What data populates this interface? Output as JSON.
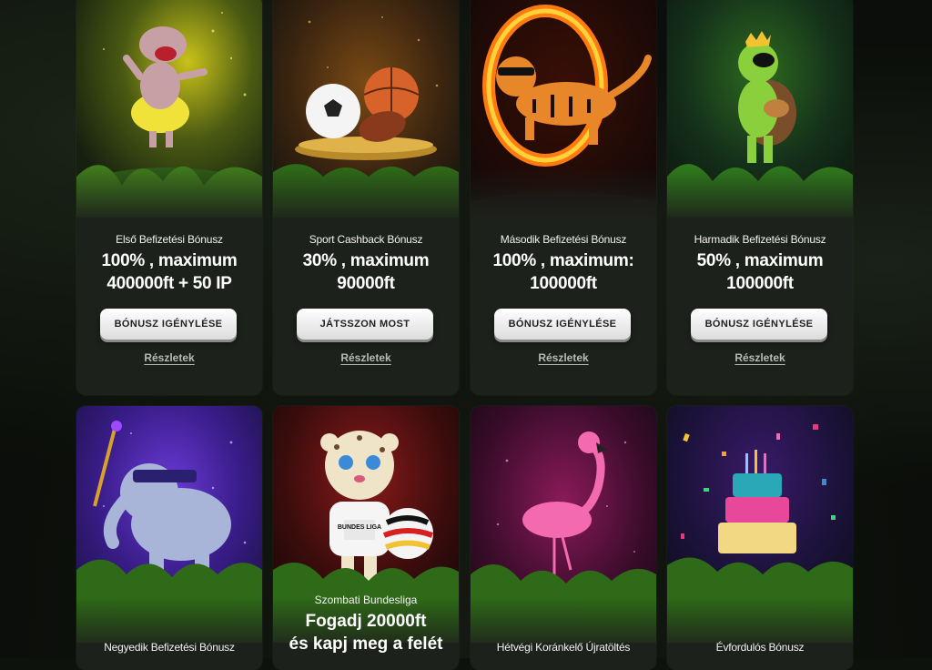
{
  "cards_row1": [
    {
      "title": "Első Befizetési Bónusz",
      "amount_line1": "100% , maximum",
      "amount_line2": "400000ft + 50 IP",
      "button": "BÓNUSZ IGÉNYLÉSE",
      "link": "Részletek",
      "art": "hippo-dancer"
    },
    {
      "title": "Sport Cashback Bónusz",
      "amount_line1": "30% , maximum",
      "amount_line2": "90000ft",
      "button": "JÁTSSZON MOST",
      "link": "Részletek",
      "art": "sports-balls"
    },
    {
      "title": "Második Befizetési Bónusz",
      "amount_line1": "100% , maximum:",
      "amount_line2": "100000ft",
      "button": "BÓNUSZ IGÉNYLÉSE",
      "link": "Részletek",
      "art": "tiger-fire-ring"
    },
    {
      "title": "Harmadik Befizetési Bónusz",
      "amount_line1": "50% , maximum",
      "amount_line2": "100000ft",
      "button": "BÓNUSZ IGÉNYLÉSE",
      "link": "Részletek",
      "art": "turtle-guitar"
    }
  ],
  "cards_row2": [
    {
      "title": "Negyedik Befizetési Bónusz",
      "art": "elephant-cane"
    },
    {
      "subtitle": "Szombati Bundesliga",
      "amount_line1": "Fogadj 20000ft",
      "amount_line2": "és kapj meg a felét",
      "badge": "BUNDES LIGA",
      "art": "leopard-football"
    },
    {
      "title": "Hétvégi Koránkelő Újratöltés",
      "art": "flamingo"
    },
    {
      "title": "Évfordulós Bónusz",
      "art": "birthday-cake"
    }
  ],
  "colors": {
    "page_bg": "#0e120d",
    "card_bg": "#1d211b",
    "button_bg": "#ffffff",
    "button_text": "#222222",
    "link_text": "#b9bbb5"
  }
}
